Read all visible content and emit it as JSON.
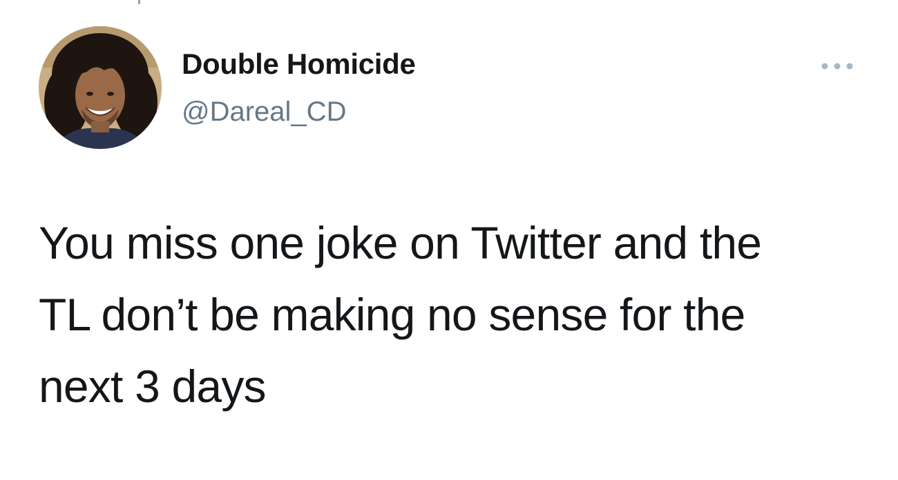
{
  "tweet": {
    "author": {
      "display_name": "Double Homicide",
      "handle": "@Dareal_CD",
      "avatar_icon": "profile-photo"
    },
    "more_icon": "more-options-icon",
    "text_lines": [
      "You miss one joke on Twitter and the",
      "TL don’t be making no sense for the",
      "next 3 days"
    ]
  },
  "colors": {
    "text": "#14171a",
    "handle": "#657786",
    "more_dots": "#aab8c2",
    "background": "#ffffff"
  }
}
